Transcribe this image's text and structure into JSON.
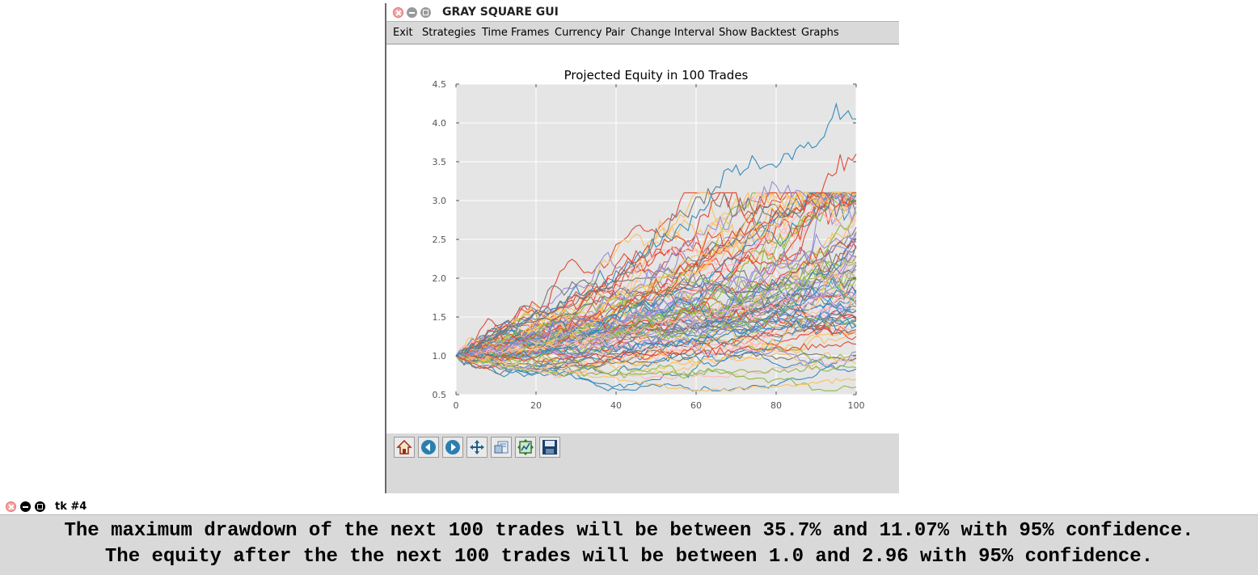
{
  "window": {
    "title": "GRAY SQUARE GUI",
    "menu": [
      "Exit",
      "Strategies",
      "Time Frames",
      "Currency Pair",
      "Change Interval",
      "Show Backtest",
      "Graphs"
    ]
  },
  "toolbar": {
    "icons": [
      "home-icon",
      "back-icon",
      "forward-icon",
      "pan-icon",
      "zoom-icon",
      "configure-subplots-icon",
      "save-icon"
    ]
  },
  "chart_data": {
    "type": "line",
    "title": "Projected Equity in 100 Trades",
    "xlabel": "",
    "ylabel": "",
    "xlim": [
      0,
      100
    ],
    "ylim": [
      0.5,
      4.5
    ],
    "xticks": [
      "0",
      "20",
      "40",
      "60",
      "80",
      "100"
    ],
    "yticks": [
      "0.5",
      "1.0",
      "1.5",
      "2.0",
      "2.5",
      "3.0",
      "3.5",
      "4.0",
      "4.5"
    ],
    "grid": true,
    "legend": "none",
    "num_series": 100,
    "colors": [
      "#348abd",
      "#e24a33",
      "#988ed5",
      "#777777",
      "#fbc15e",
      "#8eba42",
      "#ffb5b8"
    ],
    "series": [
      {
        "x": [
          0,
          20,
          40,
          60,
          70,
          80,
          90,
          95,
          100
        ],
        "values": [
          1.0,
          1.5,
          2.05,
          2.8,
          3.4,
          3.5,
          3.8,
          4.15,
          4.05
        ]
      },
      {
        "x": [
          0,
          20,
          40,
          60,
          80,
          90,
          100
        ],
        "values": [
          1.0,
          1.25,
          1.6,
          2.2,
          2.8,
          3.1,
          3.6
        ]
      },
      {
        "x": [
          0,
          20,
          40,
          60,
          80,
          90,
          100
        ],
        "values": [
          1.0,
          1.3,
          1.7,
          2.5,
          3.2,
          3.0,
          3.05
        ]
      },
      {
        "x": [
          0,
          20,
          40,
          60,
          80,
          100
        ],
        "values": [
          1.0,
          1.55,
          1.95,
          3.05,
          2.85,
          2.95
        ]
      },
      {
        "x": [
          0,
          20,
          40,
          60,
          80,
          100
        ],
        "values": [
          1.0,
          0.85,
          0.7,
          0.55,
          0.6,
          0.7
        ]
      },
      {
        "x": [
          0,
          20,
          40,
          60,
          80,
          100
        ],
        "values": [
          1.0,
          0.8,
          0.75,
          0.78,
          0.8,
          0.85
        ]
      },
      {
        "x": [
          0,
          20,
          40,
          60,
          80,
          100
        ],
        "values": [
          1.0,
          1.1,
          1.25,
          1.5,
          1.8,
          2.1
        ]
      },
      {
        "x": [
          0,
          20,
          40,
          60,
          80,
          100
        ],
        "values": [
          1.0,
          1.05,
          1.1,
          1.2,
          1.35,
          1.5
        ]
      },
      {
        "x": [
          0,
          20,
          40,
          60,
          80,
          100
        ],
        "values": [
          1.0,
          0.95,
          1.0,
          1.05,
          1.1,
          1.15
        ]
      },
      {
        "x": [
          0,
          20,
          40,
          60,
          80,
          100
        ],
        "values": [
          1.0,
          1.2,
          1.4,
          1.75,
          2.2,
          2.6
        ]
      }
    ]
  },
  "messages": {
    "line1": "The maximum drawdown of the next 100 trades will be between 35.7% and 11.07% with 95% confidence.",
    "line2": "The equity after the the next 100 trades will be between 1.0 and 2.96 with 95% confidence."
  },
  "tk": {
    "title": "tk #4"
  }
}
